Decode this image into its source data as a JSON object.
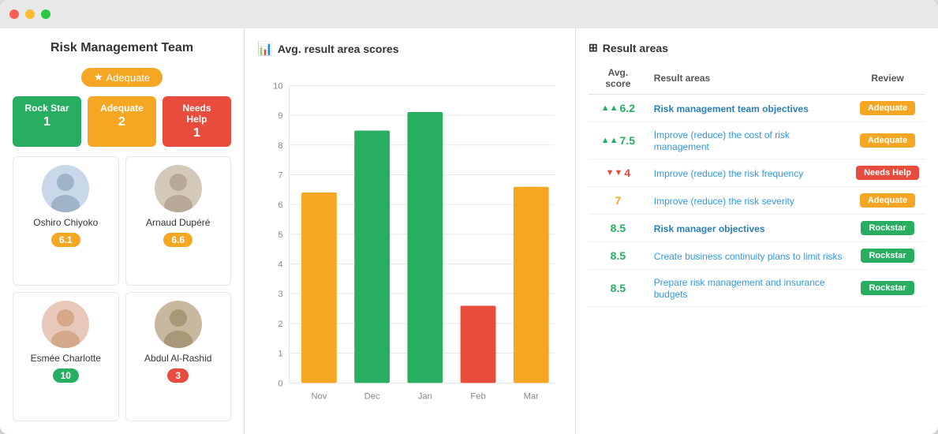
{
  "window": {
    "dots": [
      "red",
      "yellow",
      "green"
    ]
  },
  "left": {
    "title": "Risk Management Team",
    "overall_badge": "Adequate",
    "score_badges": [
      {
        "label": "Rock Star",
        "count": "1",
        "color": "green"
      },
      {
        "label": "Adequate",
        "count": "2",
        "color": "orange"
      },
      {
        "label": "Needs Help",
        "count": "1",
        "color": "red"
      }
    ],
    "members": [
      {
        "name": "Oshiro Chiyoko",
        "score": "6.1",
        "score_color": "orange"
      },
      {
        "name": "Arnaud Dupéré",
        "score": "6.6",
        "score_color": "orange"
      },
      {
        "name": "Esmée Charlotte",
        "score": "10",
        "score_color": "green"
      },
      {
        "name": "Abdul Al-Rashid",
        "score": "3",
        "score_color": "red"
      }
    ]
  },
  "chart": {
    "title": "Avg. result area scores",
    "y_max": 10,
    "y_labels": [
      "10",
      "9",
      "8",
      "7",
      "6",
      "5",
      "4",
      "3",
      "2",
      "1",
      "0"
    ],
    "bars": [
      {
        "month": "Nov",
        "value": 6.4,
        "color": "#f5a623"
      },
      {
        "month": "Dec",
        "value": 8.5,
        "color": "#27ae60"
      },
      {
        "month": "Jan",
        "value": 9.1,
        "color": "#27ae60"
      },
      {
        "month": "Feb",
        "value": 2.6,
        "color": "#e74c3c"
      },
      {
        "month": "Mar",
        "value": 6.6,
        "color": "#f5a623"
      }
    ]
  },
  "results": {
    "title": "Result areas",
    "col_headers": [
      "Avg. score",
      "Result areas",
      "Review"
    ],
    "rows": [
      {
        "score": "6.2",
        "score_color": "green",
        "arrow": "up",
        "name": "Risk management team objectives",
        "bold": true,
        "review": "Adequate",
        "review_class": "rb-adequate"
      },
      {
        "score": "7.5",
        "score_color": "green",
        "arrow": "up",
        "name": "Improve (reduce) the cost of risk management",
        "bold": false,
        "review": "Adequate",
        "review_class": "rb-adequate"
      },
      {
        "score": "4",
        "score_color": "red",
        "arrow": "down",
        "name": "Improve (reduce) the risk frequency",
        "bold": false,
        "review": "Needs Help",
        "review_class": "rb-needshelp"
      },
      {
        "score": "7",
        "score_color": "orange",
        "arrow": "none",
        "name": "Improve (reduce) the risk severity",
        "bold": false,
        "review": "Adequate",
        "review_class": "rb-adequate"
      },
      {
        "score": "8.5",
        "score_color": "green",
        "arrow": "none",
        "name": "Risk manager objectives",
        "bold": true,
        "review": "Rockstar",
        "review_class": "rb-rockstar"
      },
      {
        "score": "8.5",
        "score_color": "green",
        "arrow": "none",
        "name": "Create business continuity plans to limit risks",
        "bold": false,
        "review": "Rockstar",
        "review_class": "rb-rockstar"
      },
      {
        "score": "8.5",
        "score_color": "green",
        "arrow": "none",
        "name": "Prepare risk management and insurance budgets",
        "bold": false,
        "review": "Rockstar",
        "review_class": "rb-rockstar"
      }
    ]
  }
}
